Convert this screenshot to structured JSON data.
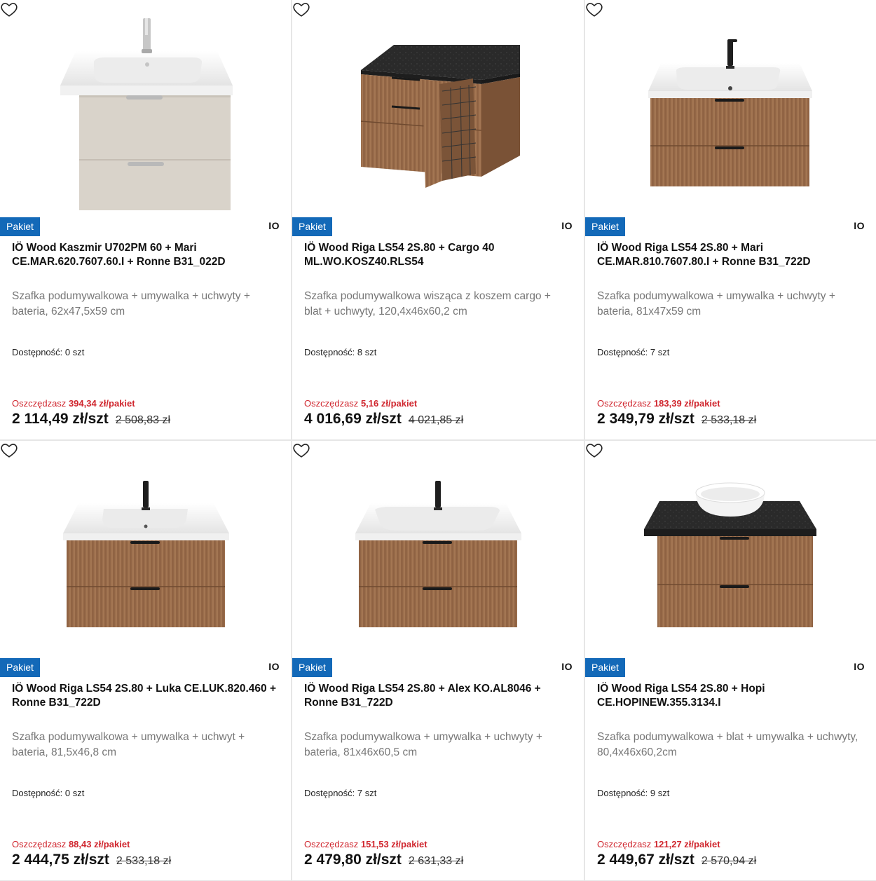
{
  "products": [
    {
      "badge": "Pakiet",
      "brand": "IO",
      "title": "IÖ Wood Kaszmir U702PM 60 + Mari CE.MAR.620.7607.60.I + Ronne B31_022D",
      "description": "Szafka podumywalkowa + umywalka + uchwyty + bateria, 62x47,5x59 cm",
      "availability_label": "Dostępność:",
      "availability_value": "0 szt",
      "save_label": "Oszczędzasz",
      "save_amount": "394,34 zł/pakiet",
      "price": "2 114,49 zł/szt",
      "old_price": "2 508,83 zł",
      "image": "beige-cabinet-white-sink-chrome-faucet"
    },
    {
      "badge": "Pakiet",
      "brand": "IO",
      "title": "IÖ Wood Riga LS54 2S.80 + Cargo 40 ML.WO.KOSZ40.RLS54",
      "description": "Szafka podumywalkowa wisząca z koszem cargo + blat + uchwyty, 120,4x46x60,2 cm",
      "availability_label": "Dostępność:",
      "availability_value": "8 szt",
      "save_label": "Oszczędzasz",
      "save_amount": "5,16 zł/pakiet",
      "price": "4 016,69 zł/szt",
      "old_price": "4 021,85 zł",
      "image": "wood-cabinet-black-top-cargo-basket"
    },
    {
      "badge": "Pakiet",
      "brand": "IO",
      "title": "IÖ Wood Riga LS54 2S.80 + Mari CE.MAR.810.7607.80.I + Ronne B31_722D",
      "description": "Szafka podumywalkowa + umywalka + uchwyty + bateria, 81x47x59 cm",
      "availability_label": "Dostępność:",
      "availability_value": "7 szt",
      "save_label": "Oszczędzasz",
      "save_amount": "183,39 zł/pakiet",
      "price": "2 349,79 zł/szt",
      "old_price": "2 533,18 zł",
      "image": "wood-cabinet-white-sink-black-faucet"
    },
    {
      "badge": "Pakiet",
      "brand": "IO",
      "title": "IÖ Wood Riga LS54 2S.80 + Luka CE.LUK.820.460 + Ronne B31_722D",
      "description": "Szafka podumywalkowa + umywalka + uchwyt + bateria, 81,5x46,8 cm",
      "availability_label": "Dostępność:",
      "availability_value": "0 szt",
      "save_label": "Oszczędzasz",
      "save_amount": "88,43 zł/pakiet",
      "price": "2 444,75 zł/szt",
      "old_price": "2 533,18 zł",
      "image": "wood-cabinet-white-sink-black-faucet"
    },
    {
      "badge": "Pakiet",
      "brand": "IO",
      "title": "IÖ Wood Riga LS54 2S.80 + Alex KO.AL8046 + Ronne B31_722D",
      "description": "Szafka podumywalkowa + umywalka + uchwyty + bateria, 81x46x60,5 cm",
      "availability_label": "Dostępność:",
      "availability_value": "7 szt",
      "save_label": "Oszczędzasz",
      "save_amount": "151,53 zł/pakiet",
      "price": "2 479,80 zł/szt",
      "old_price": "2 631,33 zł",
      "image": "wood-cabinet-white-sink-black-faucet"
    },
    {
      "badge": "Pakiet",
      "brand": "IO",
      "title": "IÖ Wood Riga LS54 2S.80 + Hopi CE.HOPINEW.355.3134.I",
      "description": "Szafka podumywalkowa + blat + umywalka + uchwyty, 80,4x46x60,2cm",
      "availability_label": "Dostępność:",
      "availability_value": "9 szt",
      "save_label": "Oszczędzasz",
      "save_amount": "121,27 zł/pakiet",
      "price": "2 449,67 zł/szt",
      "old_price": "2 570,94 zł",
      "image": "wood-cabinet-black-top-vessel-bowl"
    }
  ],
  "colors": {
    "badge": "#1369b8",
    "save": "#d0262e",
    "wood": "#9a6b49",
    "beige": "#d8d2c9",
    "stone": "#2b2b2b"
  },
  "icons": {
    "favorite": "heart-outline-icon"
  }
}
